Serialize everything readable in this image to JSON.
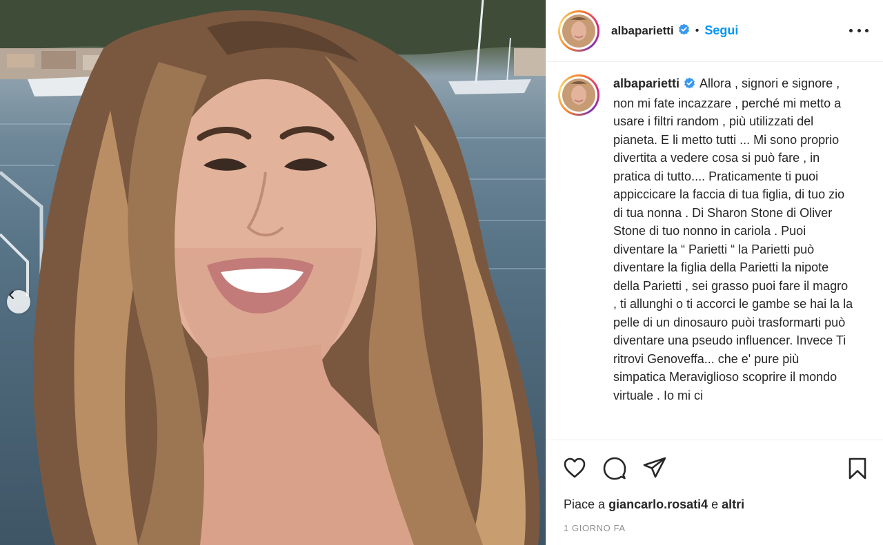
{
  "post": {
    "username": "albaparietti",
    "follow_label": "Segui",
    "separator": "•",
    "caption": "Allora , signori e signore , non mi fate incazzare , perché mi metto a usare i filtri random , più utilizzati del pianeta. E li metto tutti ... Mi sono proprio divertita a vedere cosa si può fare , in pratica di tutto.... Praticamente ti puoi appiccicare la faccia di tua figlia, di tuo zio di tua nonna . Di Sharon Stone di Oliver Stone di tuo nonno in cariola . Puoi diventare la “ Parietti “ la Parietti può diventare la figlia della Parietti la nipote della Parietti , sei grasso puoi fare il magro , ti allunghi o ti accorci le gambe se hai la la pelle di un dinosauro puòi trasformarti può diventare una pseudo influencer. Invece Ti ritrovi Genoveffa... che e' pure più simpatica Meraviglioso scoprire il mondo virtuale . Io mi ci",
    "likes_prefix": "Piace a",
    "likes_user": "giancarlo.rosati4",
    "likes_connector": "e",
    "likes_suffix": "altri",
    "timestamp": "1 GIORNO FA"
  },
  "icons": {
    "verified": "verified-badge-icon",
    "more": "more-options-icon",
    "like": "heart-icon",
    "comment": "comment-icon",
    "share": "paper-plane-icon",
    "save": "bookmark-icon",
    "prev": "chevron-left-icon"
  },
  "colors": {
    "follow": "#0095f6",
    "verified": "#3897f0",
    "text": "#262626",
    "muted": "#8e8e8e",
    "border": "#efefef"
  }
}
